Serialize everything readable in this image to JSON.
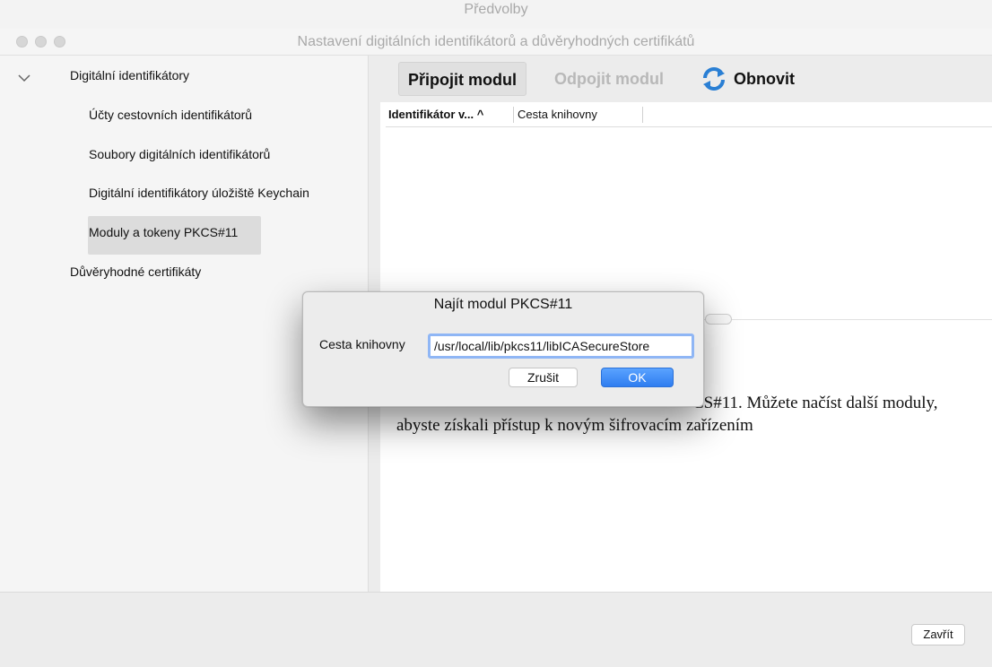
{
  "back_window": {
    "title": "Předvolby"
  },
  "window": {
    "title": "Nastavení digitálních identifikátorů a důvěryhodných certifikátů"
  },
  "sidebar": {
    "items": [
      {
        "label": "Digitální identifikátory",
        "icon": "chevron-down-icon",
        "expanded": true
      },
      {
        "label": "Účty cestovních identifikátorů"
      },
      {
        "label": "Soubory digitálních identifikátorů"
      },
      {
        "label": "Digitální identifikátory úložiště Keychain"
      },
      {
        "label": "Moduly a tokeny PKCS#11",
        "selected": true
      },
      {
        "label": "Důvěryhodné certifikáty"
      }
    ]
  },
  "toolbar": {
    "connect_label": "Připojit modul",
    "disconnect_label": "Odpojit modul",
    "refresh_label": "Obnovit",
    "refresh_icon": "refresh-icon"
  },
  "table": {
    "columns": [
      "Identifikátor v... ^",
      "Cesta knihovny"
    ]
  },
  "description": {
    "line1": "CS#11. Můžete načíst další moduly,",
    "line2": "abyste získali přístup k novým šifrovacím zařízením"
  },
  "dialog": {
    "title": "Najít modul PKCS#11",
    "label": "Cesta knihovny",
    "input_value": "/usr/local/lib/pkcs11/libICASecureStore",
    "cancel_label": "Zrušit",
    "ok_label": "OK"
  },
  "footer": {
    "close_label": "Zavřít"
  },
  "colors": {
    "accent": "#2f7df0",
    "focus_ring": "#8fb6f5",
    "refresh_icon": "#2a7fd4"
  }
}
